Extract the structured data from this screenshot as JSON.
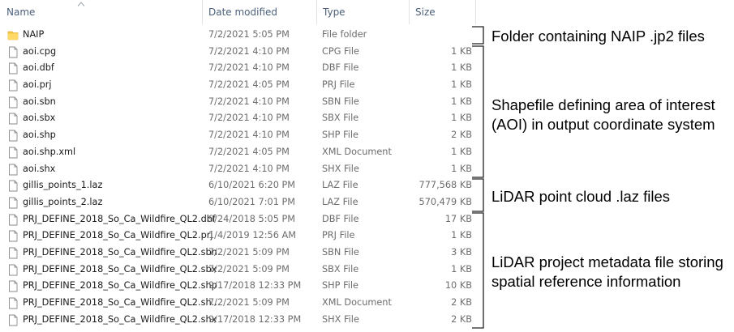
{
  "header": {
    "name": "Name",
    "date": "Date modified",
    "type": "Type",
    "size": "Size"
  },
  "files": [
    {
      "name": "NAIP",
      "date": "7/2/2021 5:05 PM",
      "type": "File folder",
      "size": "",
      "icon": "folder-icon"
    },
    {
      "name": "aoi.cpg",
      "date": "7/2/2021 4:10 PM",
      "type": "CPG File",
      "size": "1 KB",
      "icon": "file-icon"
    },
    {
      "name": "aoi.dbf",
      "date": "7/2/2021 4:10 PM",
      "type": "DBF File",
      "size": "1 KB",
      "icon": "file-icon"
    },
    {
      "name": "aoi.prj",
      "date": "7/2/2021 4:05 PM",
      "type": "PRJ File",
      "size": "1 KB",
      "icon": "file-icon"
    },
    {
      "name": "aoi.sbn",
      "date": "7/2/2021 4:10 PM",
      "type": "SBN File",
      "size": "1 KB",
      "icon": "file-icon"
    },
    {
      "name": "aoi.sbx",
      "date": "7/2/2021 4:10 PM",
      "type": "SBX File",
      "size": "1 KB",
      "icon": "file-icon"
    },
    {
      "name": "aoi.shp",
      "date": "7/2/2021 4:10 PM",
      "type": "SHP File",
      "size": "2 KB",
      "icon": "file-icon"
    },
    {
      "name": "aoi.shp.xml",
      "date": "7/2/2021 4:05 PM",
      "type": "XML Document",
      "size": "1 KB",
      "icon": "file-icon"
    },
    {
      "name": "aoi.shx",
      "date": "7/2/2021 4:10 PM",
      "type": "SHX File",
      "size": "1 KB",
      "icon": "file-icon"
    },
    {
      "name": "gillis_points_1.laz",
      "date": "6/10/2021 6:20 PM",
      "type": "LAZ File",
      "size": "777,568 KB",
      "icon": "file-icon"
    },
    {
      "name": "gillis_points_2.laz",
      "date": "6/10/2021 7:01 PM",
      "type": "LAZ File",
      "size": "570,479 KB",
      "icon": "file-icon"
    },
    {
      "name": "PRJ_DEFINE_2018_So_Ca_Wildfire_QL2.dbf",
      "date": "9/24/2018 5:05 PM",
      "type": "DBF File",
      "size": "17 KB",
      "icon": "file-icon"
    },
    {
      "name": "PRJ_DEFINE_2018_So_Ca_Wildfire_QL2.prj",
      "date": "1/4/2019 12:56 AM",
      "type": "PRJ File",
      "size": "1 KB",
      "icon": "file-icon"
    },
    {
      "name": "PRJ_DEFINE_2018_So_Ca_Wildfire_QL2.sbn",
      "date": "7/2/2021 5:09 PM",
      "type": "SBN File",
      "size": "3 KB",
      "icon": "file-icon"
    },
    {
      "name": "PRJ_DEFINE_2018_So_Ca_Wildfire_QL2.sbx",
      "date": "7/2/2021 5:09 PM",
      "type": "SBX File",
      "size": "1 KB",
      "icon": "file-icon"
    },
    {
      "name": "PRJ_DEFINE_2018_So_Ca_Wildfire_QL2.shp",
      "date": "9/17/2018 12:33 PM",
      "type": "SHP File",
      "size": "10 KB",
      "icon": "file-icon"
    },
    {
      "name": "PRJ_DEFINE_2018_So_Ca_Wildfire_QL2.sh...",
      "date": "7/2/2021 5:09 PM",
      "type": "XML Document",
      "size": "2 KB",
      "icon": "file-icon"
    },
    {
      "name": "PRJ_DEFINE_2018_So_Ca_Wildfire_QL2.shx",
      "date": "9/17/2018 12:33 PM",
      "type": "SHX File",
      "size": "2 KB",
      "icon": "file-icon"
    }
  ],
  "annotations": {
    "naip": "Folder containing NAIP .jp2 files",
    "shapefile_line1": "Shapefile defining area of interest",
    "shapefile_line2": "(AOI) in output coordinate system",
    "lidar": "LiDAR point cloud .laz files",
    "metadata_line1": "LiDAR project metadata file storing",
    "metadata_line2": "spatial reference information"
  },
  "colors": {
    "header_text": "#4c607a",
    "folder": "#f4c542",
    "meta_text": "#6d6d6d"
  }
}
